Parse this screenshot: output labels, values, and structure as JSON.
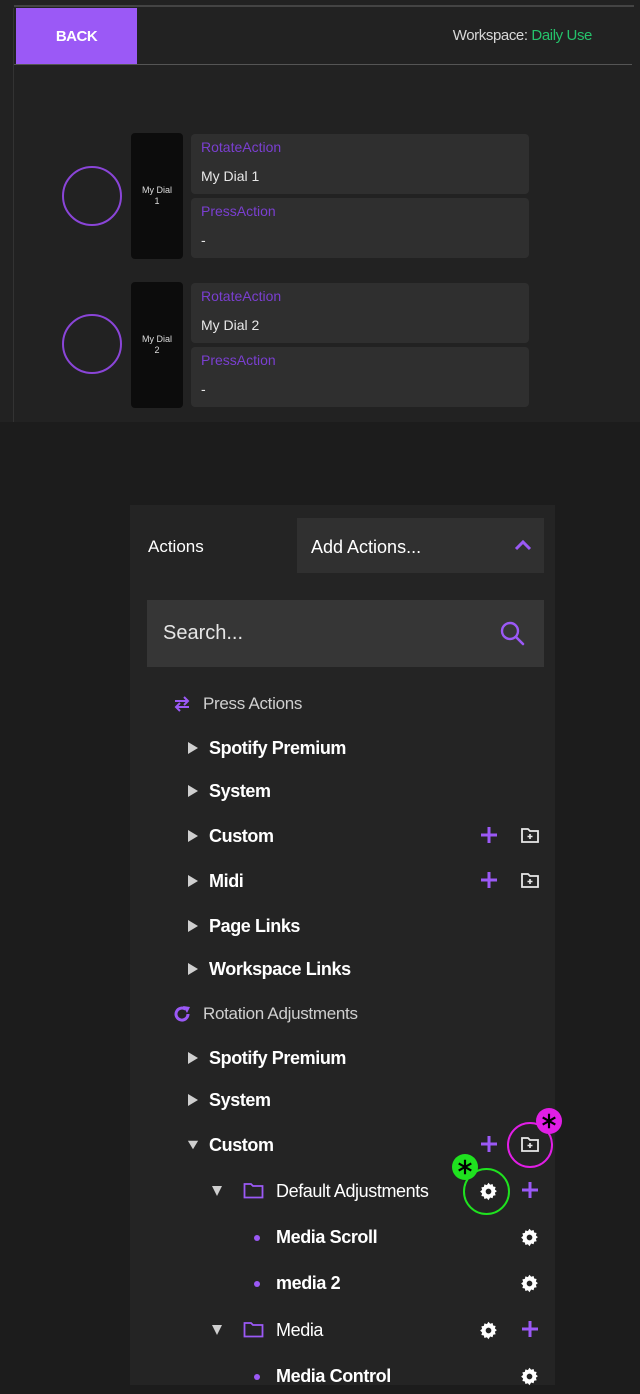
{
  "header": {
    "back_label": "BACK",
    "workspace_prefix": "Workspace: ",
    "workspace_name": "Daily Use"
  },
  "dials": [
    {
      "tile_label": "My Dial 1",
      "rotate_label": "RotateAction",
      "rotate_value": "My Dial 1",
      "press_label": "PressAction",
      "press_value": "-"
    },
    {
      "tile_label": "My Dial 2",
      "rotate_label": "RotateAction",
      "rotate_value": "My Dial 2",
      "press_label": "PressAction",
      "press_value": "-"
    }
  ],
  "actions_panel": {
    "title": "Actions",
    "add_actions_label": "Add Actions...",
    "search_placeholder": "Search...",
    "sections": [
      {
        "label": "Press Actions",
        "icon": "swap-arrows-icon",
        "items": [
          "Spotify Premium",
          "System",
          "Custom",
          "Midi",
          "Page Links",
          "Workspace Links"
        ]
      },
      {
        "label": "Rotation Adjustments",
        "icon": "rotate-icon",
        "items": [
          "Spotify Premium",
          "System",
          "Custom"
        ],
        "custom_children": [
          {
            "label": "Default Adjustments",
            "children": [
              "Media Scroll",
              "media 2"
            ]
          },
          {
            "label": "Media",
            "children": [
              "Media Control"
            ]
          }
        ]
      }
    ]
  },
  "colors": {
    "accent": "#9b59f6",
    "workspace_name": "#25c26b",
    "annotation_magenta": "#e11ee6",
    "annotation_green": "#1fe21f"
  }
}
